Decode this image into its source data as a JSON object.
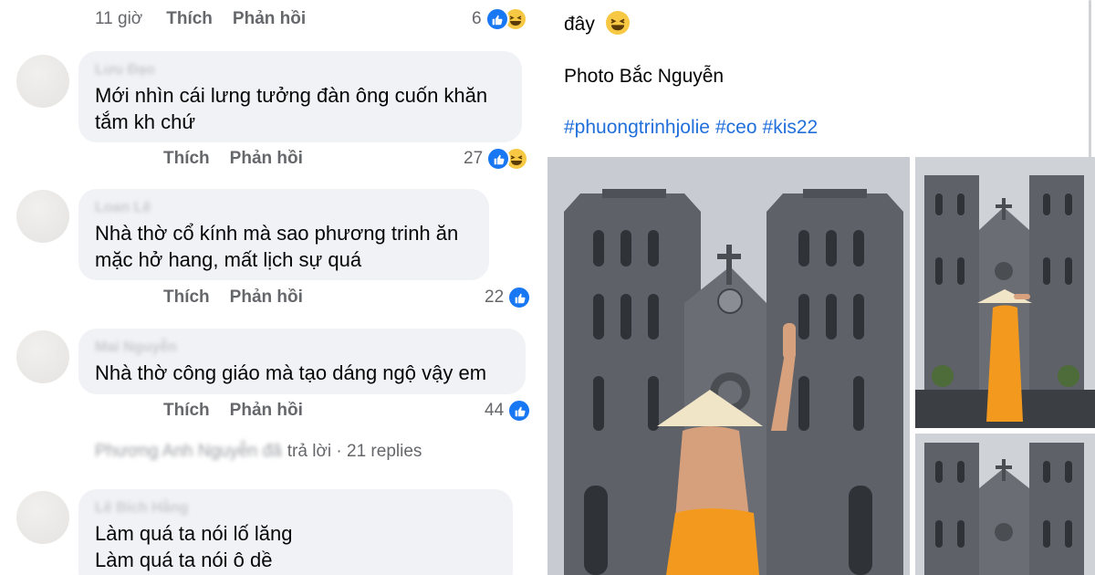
{
  "comments_panel": {
    "top_row": {
      "time": "11 giờ",
      "like": "Thích",
      "reply": "Phản hồi",
      "count": "6"
    },
    "comments": [
      {
        "author": "Lưu Đạo",
        "lines": [
          "Mới nhìn cái lưng tưởng đàn ông cuốn khăn",
          "tắm kh chứ"
        ],
        "like": "Thích",
        "reply": "Phản hồi",
        "count": "27",
        "reactions": [
          "like",
          "haha"
        ]
      },
      {
        "author": "Loan Lê",
        "lines": [
          "Nhà thờ cổ kính mà sao phương trinh ăn",
          "mặc hở hang, mất lịch sự quá"
        ],
        "like": "Thích",
        "reply": "Phản hồi",
        "count": "22",
        "reactions": [
          "like"
        ]
      },
      {
        "author": "Mai Nguyễn",
        "lines": [
          "Nhà thờ công giáo mà tạo dáng ngộ vậy em"
        ],
        "like": "Thích",
        "reply": "Phản hồi",
        "count": "44",
        "reactions": [
          "like"
        ]
      },
      {
        "author": "Lê Bích Hằng",
        "lines": [
          "Làm quá ta nói lố lăng",
          "Làm quá ta nói ô dề"
        ]
      }
    ],
    "replies_summary": {
      "blurred": "Phương Anh Nguyễn đã",
      "clear": "trả lời · 21 replies"
    }
  },
  "post": {
    "line1": "đây",
    "photo_credit": "Photo Bắc Nguyễn",
    "hashtags": [
      "#phuongtrinhjolie",
      "#ceo",
      "#kis22"
    ]
  },
  "colors": {
    "like_blue": "#1877f2",
    "haha_yellow": "#f7c843",
    "hashtag_blue": "#216fdb",
    "bubble_bg": "#f0f2f5",
    "dress_orange": "#f39a1e"
  },
  "icons": [
    "like-icon",
    "haha-icon"
  ]
}
